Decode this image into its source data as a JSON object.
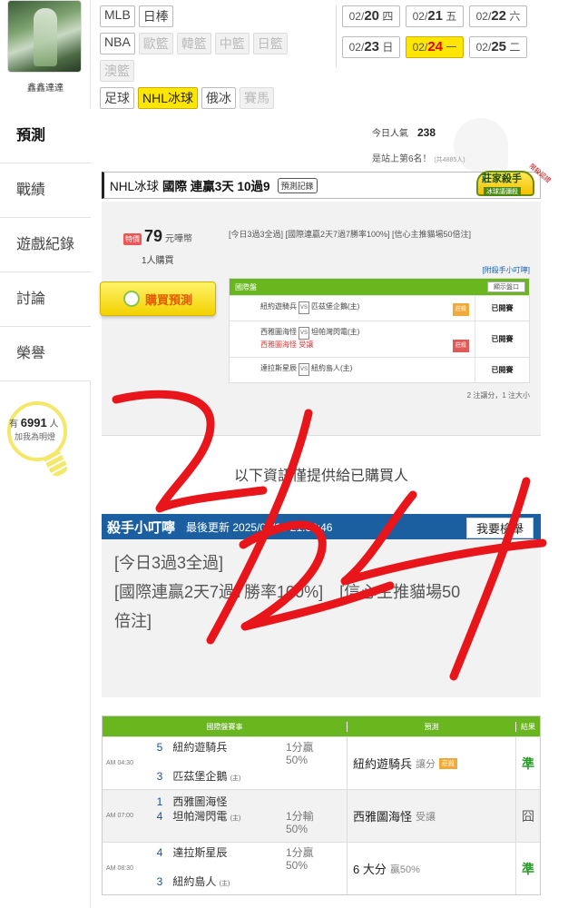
{
  "user": {
    "name": "鑫鑫達達",
    "fans_prefix": "有",
    "fans_count": "6991",
    "fans_suffix": "人",
    "fans_sub": "加我為明燈"
  },
  "sidebar": {
    "items": [
      {
        "label": "預測",
        "active": true
      },
      {
        "label": "戰績",
        "active": false
      },
      {
        "label": "遊戲紀錄",
        "active": false
      },
      {
        "label": "討論",
        "active": false
      },
      {
        "label": "榮譽",
        "active": false
      }
    ]
  },
  "categories": {
    "row1": [
      {
        "label": "MLB",
        "state": "normal"
      },
      {
        "label": "日棒",
        "state": "normal"
      }
    ],
    "row2": [
      {
        "label": "NBA",
        "state": "normal"
      },
      {
        "label": "歐籃",
        "state": "disabled"
      },
      {
        "label": "韓籃",
        "state": "disabled"
      },
      {
        "label": "中籃",
        "state": "disabled"
      },
      {
        "label": "日籃",
        "state": "disabled"
      }
    ],
    "row3": [
      {
        "label": "澳籃",
        "state": "disabled"
      }
    ],
    "row4": [
      {
        "label": "足球",
        "state": "normal"
      },
      {
        "label": "NHL冰球",
        "state": "active"
      },
      {
        "label": "俄冰",
        "state": "normal"
      },
      {
        "label": "賽馬",
        "state": "disabled"
      }
    ]
  },
  "dates": {
    "row1": [
      {
        "md": "02/",
        "day": "20",
        "wd": "四",
        "active": false
      },
      {
        "md": "02/",
        "day": "21",
        "wd": "五",
        "active": false
      },
      {
        "md": "02/",
        "day": "22",
        "wd": "六",
        "active": false
      }
    ],
    "row2": [
      {
        "md": "02/",
        "day": "23",
        "wd": "日",
        "active": false
      },
      {
        "md": "02/",
        "day": "24",
        "wd": "一",
        "active": true
      },
      {
        "md": "02/",
        "day": "25",
        "wd": "二",
        "active": false
      }
    ]
  },
  "stats": {
    "popularity_label": "今日人氣",
    "popularity_value": "238",
    "rank_text": "是站上第6名！",
    "rank_small": "(共4885人)"
  },
  "title": {
    "category": "NHL冰球",
    "text": "國際 連贏3天 10過9",
    "record_button": "預測記錄",
    "badge_main": "莊家殺手",
    "badge_sub": "冰球議彌殺",
    "badge_side": "限殺認證"
  },
  "prediction": {
    "price_tag": "特價",
    "price": "79",
    "price_unit": "元嘩幣",
    "buyers": "1人購買",
    "summary": "[今日3過3全過] [國際連贏2天7過7勝率100%] [信心主推貓場50倍注]",
    "kiss_link": "[附殺手小叮嚀]",
    "buy_button": "購買預測",
    "table": {
      "header": "國際盤",
      "show_button": "顯示盤口",
      "rows": [
        {
          "away": "紐約遊騎兵",
          "vs": "VS",
          "home": "匹茲堡企鵝(主)",
          "extra": "",
          "chip": "莊殺",
          "status": "已開賽"
        },
        {
          "away": "西雅圖海怪",
          "vs": "VS",
          "home": "坦帕灣閃電(主)",
          "extra": "西雅圖海怪 受讓",
          "chip": "莊殺",
          "status": "已開賽"
        },
        {
          "away": "達拉斯星辰",
          "vs": "VS",
          "home": "紐約島人(主)",
          "extra": "",
          "chip": "",
          "status": "已開賽"
        }
      ],
      "note": "2 注讓分，1 注大小"
    }
  },
  "notice": "以下資訊僅提供給已購買人",
  "kiss": {
    "title": "殺手小叮嚀",
    "updated_label": "最後更新",
    "updated_value": "2025/02/23 21:33:46",
    "report_button": "我要檢舉",
    "line1": "[今日3過3全過]",
    "line2": "[國際連贏2天7過7勝率100%]　[信心主推貓場50",
    "line3": "倍注]"
  },
  "results": {
    "headers": {
      "game": "國際盤賽事",
      "prediction": "預測",
      "result": "結果"
    },
    "rows": [
      {
        "time": "AM 04:30",
        "n1": "5",
        "t1": "紐約遊騎兵",
        "h1": "",
        "n2": "3",
        "t2": "匹茲堡企鵝",
        "h2": "(主)",
        "line1": "1分贏",
        "line2": "50%",
        "pred": "紐約遊騎兵",
        "pred_sub": "讓分",
        "chip": "莊殺",
        "result": "準",
        "win": true
      },
      {
        "time": "AM 07:00",
        "n1": "1",
        "t1": "西雅圖海怪",
        "h1": "",
        "n2": "4",
        "t2": "坦帕灣閃電",
        "h2": "(主)",
        "line1": "1分輸",
        "line2": "50%",
        "pred": "西雅圖海怪",
        "pred_sub": "受讓",
        "chip": "",
        "result": "囧",
        "win": false
      },
      {
        "time": "AM 08:30",
        "n1": "4",
        "t1": "達拉斯星辰",
        "h1": "",
        "n2": "3",
        "t2": "紐約島人",
        "h2": "(主)",
        "line1": "1分贏",
        "line2": "50%",
        "pred": "6 大分",
        "pred_sub": "贏50%",
        "chip": "",
        "result": "準",
        "win": true
      }
    ]
  },
  "overlay": {
    "handwriting": "2/24",
    "color": "#e8151b"
  },
  "colors": {
    "accent_green": "#6ab61e",
    "accent_yellow": "#ffe600",
    "kiss_blue": "#1b5fa0"
  }
}
